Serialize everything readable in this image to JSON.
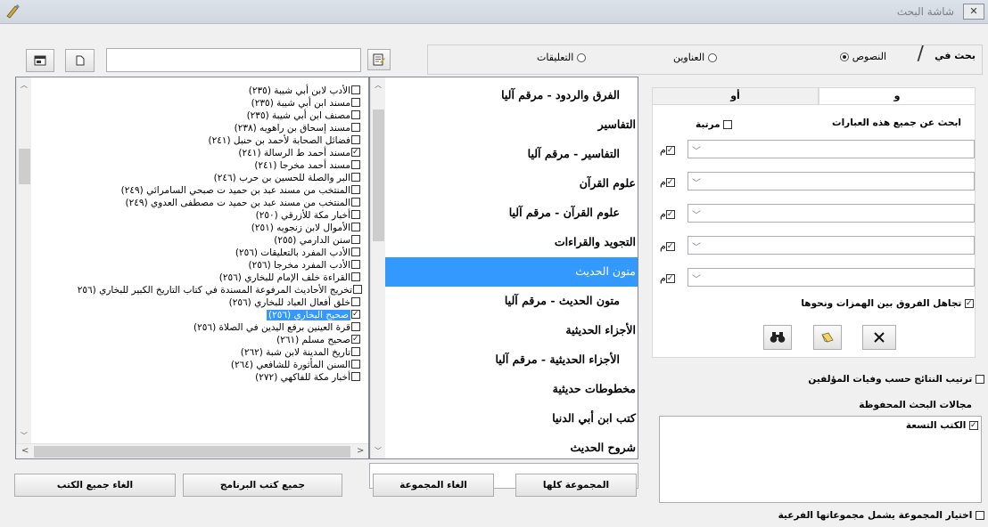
{
  "window": {
    "title": "شاشة البحث",
    "close_symbol": "⊠"
  },
  "search_in": {
    "label": "بحث في",
    "options": [
      {
        "label": "النصوص",
        "selected": true
      },
      {
        "label": "العناوين",
        "selected": false
      },
      {
        "label": "التعليقات",
        "selected": false
      }
    ]
  },
  "tabs": {
    "and_label": "و",
    "or_label": "أو"
  },
  "phrase_section": {
    "heading": "ابحث عن جميع هذه العبارات",
    "ordered_label": "مرتبة",
    "row_suffix": "م",
    "rows": 5
  },
  "ignore_hamza_label": "تجاهل الفروق بين الهمزات ونحوها",
  "sort_by_death_label": "ترتيب النتائج حسب وفيات المؤلفين",
  "saved_areas": {
    "label": "مجالات البحث المحفوظة",
    "items": [
      "الكتب التسعة"
    ]
  },
  "subgroups_label": "اختيار المجموعة يشمل مجموعاتها الفرعية",
  "categories": [
    "الفرق والردود - مرقم آليا",
    "التفاسير",
    "التفاسير - مرقم آليا",
    "علوم القرآن",
    "علوم القرآن - مرقم آليا",
    "التجويد والقراءات",
    "متون الحديث",
    "متون الحديث - مرقم آليا",
    "الأجزاء الحديثية",
    "الأجزاء الحديثية - مرقم آليا",
    "مخطوطات حديثية",
    "كتب ابن أبي الدنيا",
    "شروح الحديث"
  ],
  "selected_category": "متون الحديث",
  "books": [
    {
      "title": "الأدب لابن أبي شيبة (٢٣٥)",
      "checked": false
    },
    {
      "title": "مسند ابن أبي شيبة (٢٣٥)",
      "checked": false
    },
    {
      "title": "مصنف ابن أبي شيبة (٢٣٥)",
      "checked": false
    },
    {
      "title": "مسند إسحاق بن راهويه (٢٣٨)",
      "checked": false
    },
    {
      "title": "فضائل الصحابة لأحمد بن حنبل (٢٤١)",
      "checked": false
    },
    {
      "title": "مسند أحمد ط الرسالة (٢٤١)",
      "checked": true
    },
    {
      "title": "مسند أحمد مخرجا (٢٤١)",
      "checked": false
    },
    {
      "title": "البر والصلة للحسين بن حرب (٢٤٦)",
      "checked": false
    },
    {
      "title": "المنتخب من مسند عبد بن حميد ت صبحي السامرائي (٢٤٩)",
      "checked": false
    },
    {
      "title": "المنتخب من مسند عبد بن حميد ت مصطفى العدوي (٢٤٩)",
      "checked": false
    },
    {
      "title": "أخبار مكة للأزرقي (٢٥٠)",
      "checked": false
    },
    {
      "title": "الأموال لابن زنجويه (٢٥١)",
      "checked": false
    },
    {
      "title": "سنن الدارمي (٢٥٥)",
      "checked": false
    },
    {
      "title": "الأدب المفرد بالتعليقات (٢٥٦)",
      "checked": false
    },
    {
      "title": "الأدب المفرد مخرجا (٢٥٦)",
      "checked": false
    },
    {
      "title": "القراءة خلف الإمام للبخاري (٢٥٦)",
      "checked": false
    },
    {
      "title": "تخريج الأحاديث المرفوعة المسندة في كتاب التاريخ الكبير للبخاري (٢٥٦",
      "checked": false
    },
    {
      "title": "خلق أفعال العباد للبخاري (٢٥٦)",
      "checked": false
    },
    {
      "title": "صحيح البخاري (٢٥٦)",
      "checked": true
    },
    {
      "title": "قرة العينين برفع اليدين في الصلاة (٢٥٦)",
      "checked": false
    },
    {
      "title": "صحيح مسلم (٢٦١)",
      "checked": true
    },
    {
      "title": "تاريخ المدينة لابن شبة (٢٦٢)",
      "checked": false
    },
    {
      "title": "السنن المأثورة للشافعي (٢٦٤)",
      "checked": false
    },
    {
      "title": "أخبار مكة للفاكهي (٢٧٢)",
      "checked": false
    }
  ],
  "selected_book": "صحيح البخاري (٢٥٦)",
  "bottom_buttons": {
    "all_group": "المجموعة كلها",
    "cancel_group": "الغاء المجموعة",
    "all_program_books": "جميع كتب البرنامج",
    "cancel_all_books": "الغاء جميع الكتب"
  },
  "icons": {
    "search": "binoculars-icon",
    "clear": "eraser-icon",
    "close": "x-icon",
    "new": "new-document-icon",
    "window": "window-icon",
    "notes": "notes-icon"
  }
}
